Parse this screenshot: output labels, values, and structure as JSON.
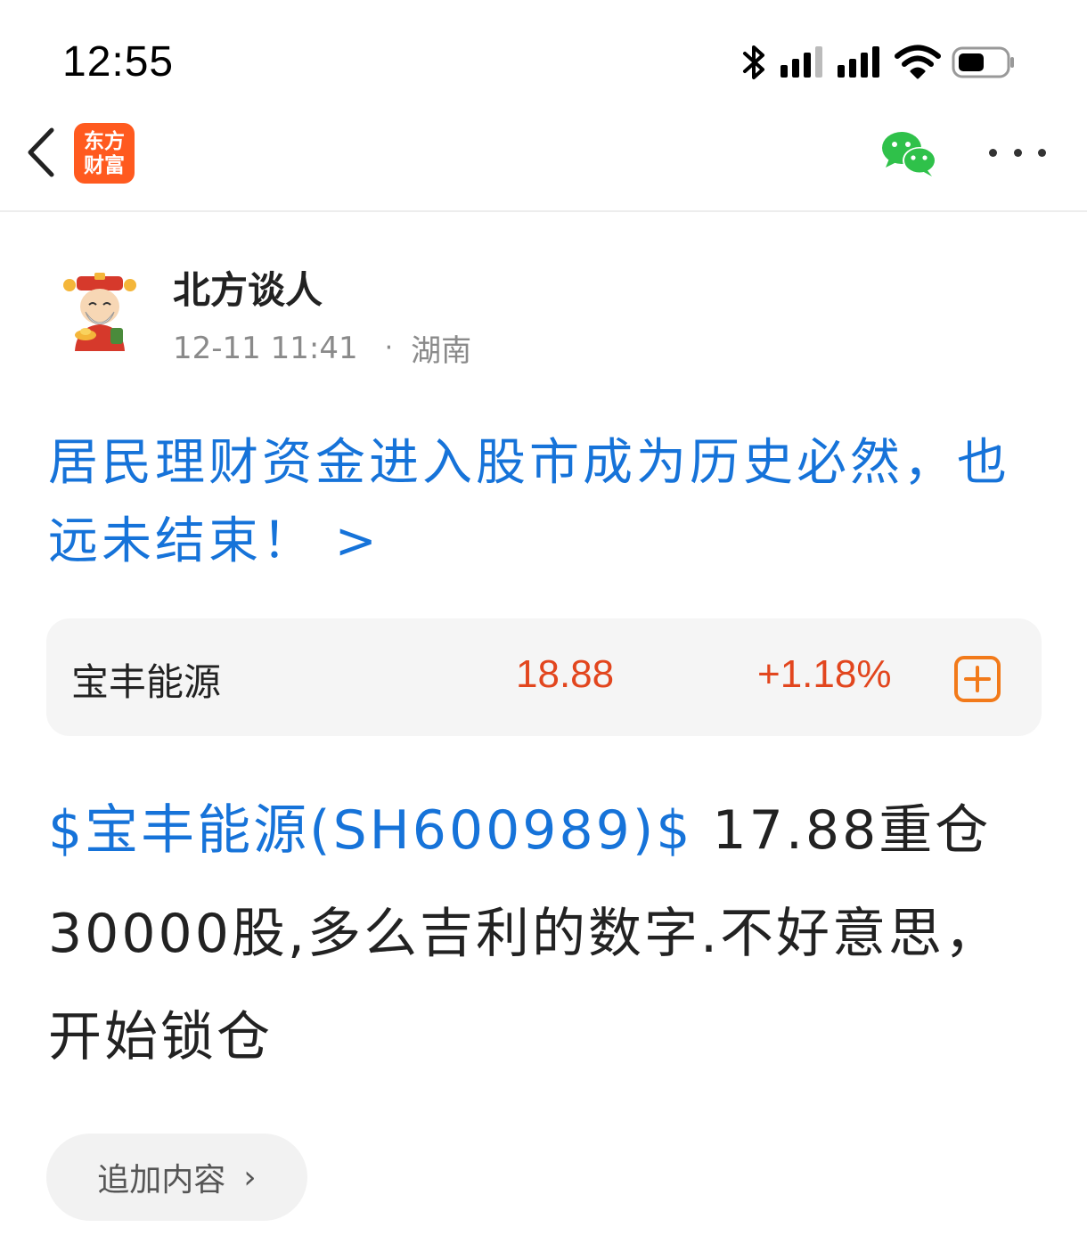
{
  "status_bar": {
    "time": "12:55",
    "icons": [
      "bluetooth-icon",
      "signal-icon",
      "signal-icon",
      "wifi-icon",
      "battery-icon"
    ]
  },
  "nav": {
    "app_logo_line1": "东方",
    "app_logo_line2": "财富",
    "icons": [
      "back-chevron-icon",
      "wechat-icon",
      "more-dots-icon"
    ],
    "logo_color": "#ff5a1f"
  },
  "author": {
    "name": "北方谈人",
    "datetime": "12-11 11:41",
    "separator": "·",
    "location": "湖南"
  },
  "article": {
    "title": "居民理财资金进入股市成为历史必然，也远未结束！ >",
    "link_color": "#1673d9"
  },
  "stock": {
    "name": "宝丰能源",
    "price": "18.88",
    "change": "+1.18%",
    "up_color": "#e2461e"
  },
  "body": {
    "stock_tag": "$宝丰能源(SH600989)$",
    "text": " 17.88重仓30000股,多么吉利的数字.不好意思，开始锁仓"
  },
  "append": {
    "label": "追加内容",
    "chevron": "›"
  }
}
